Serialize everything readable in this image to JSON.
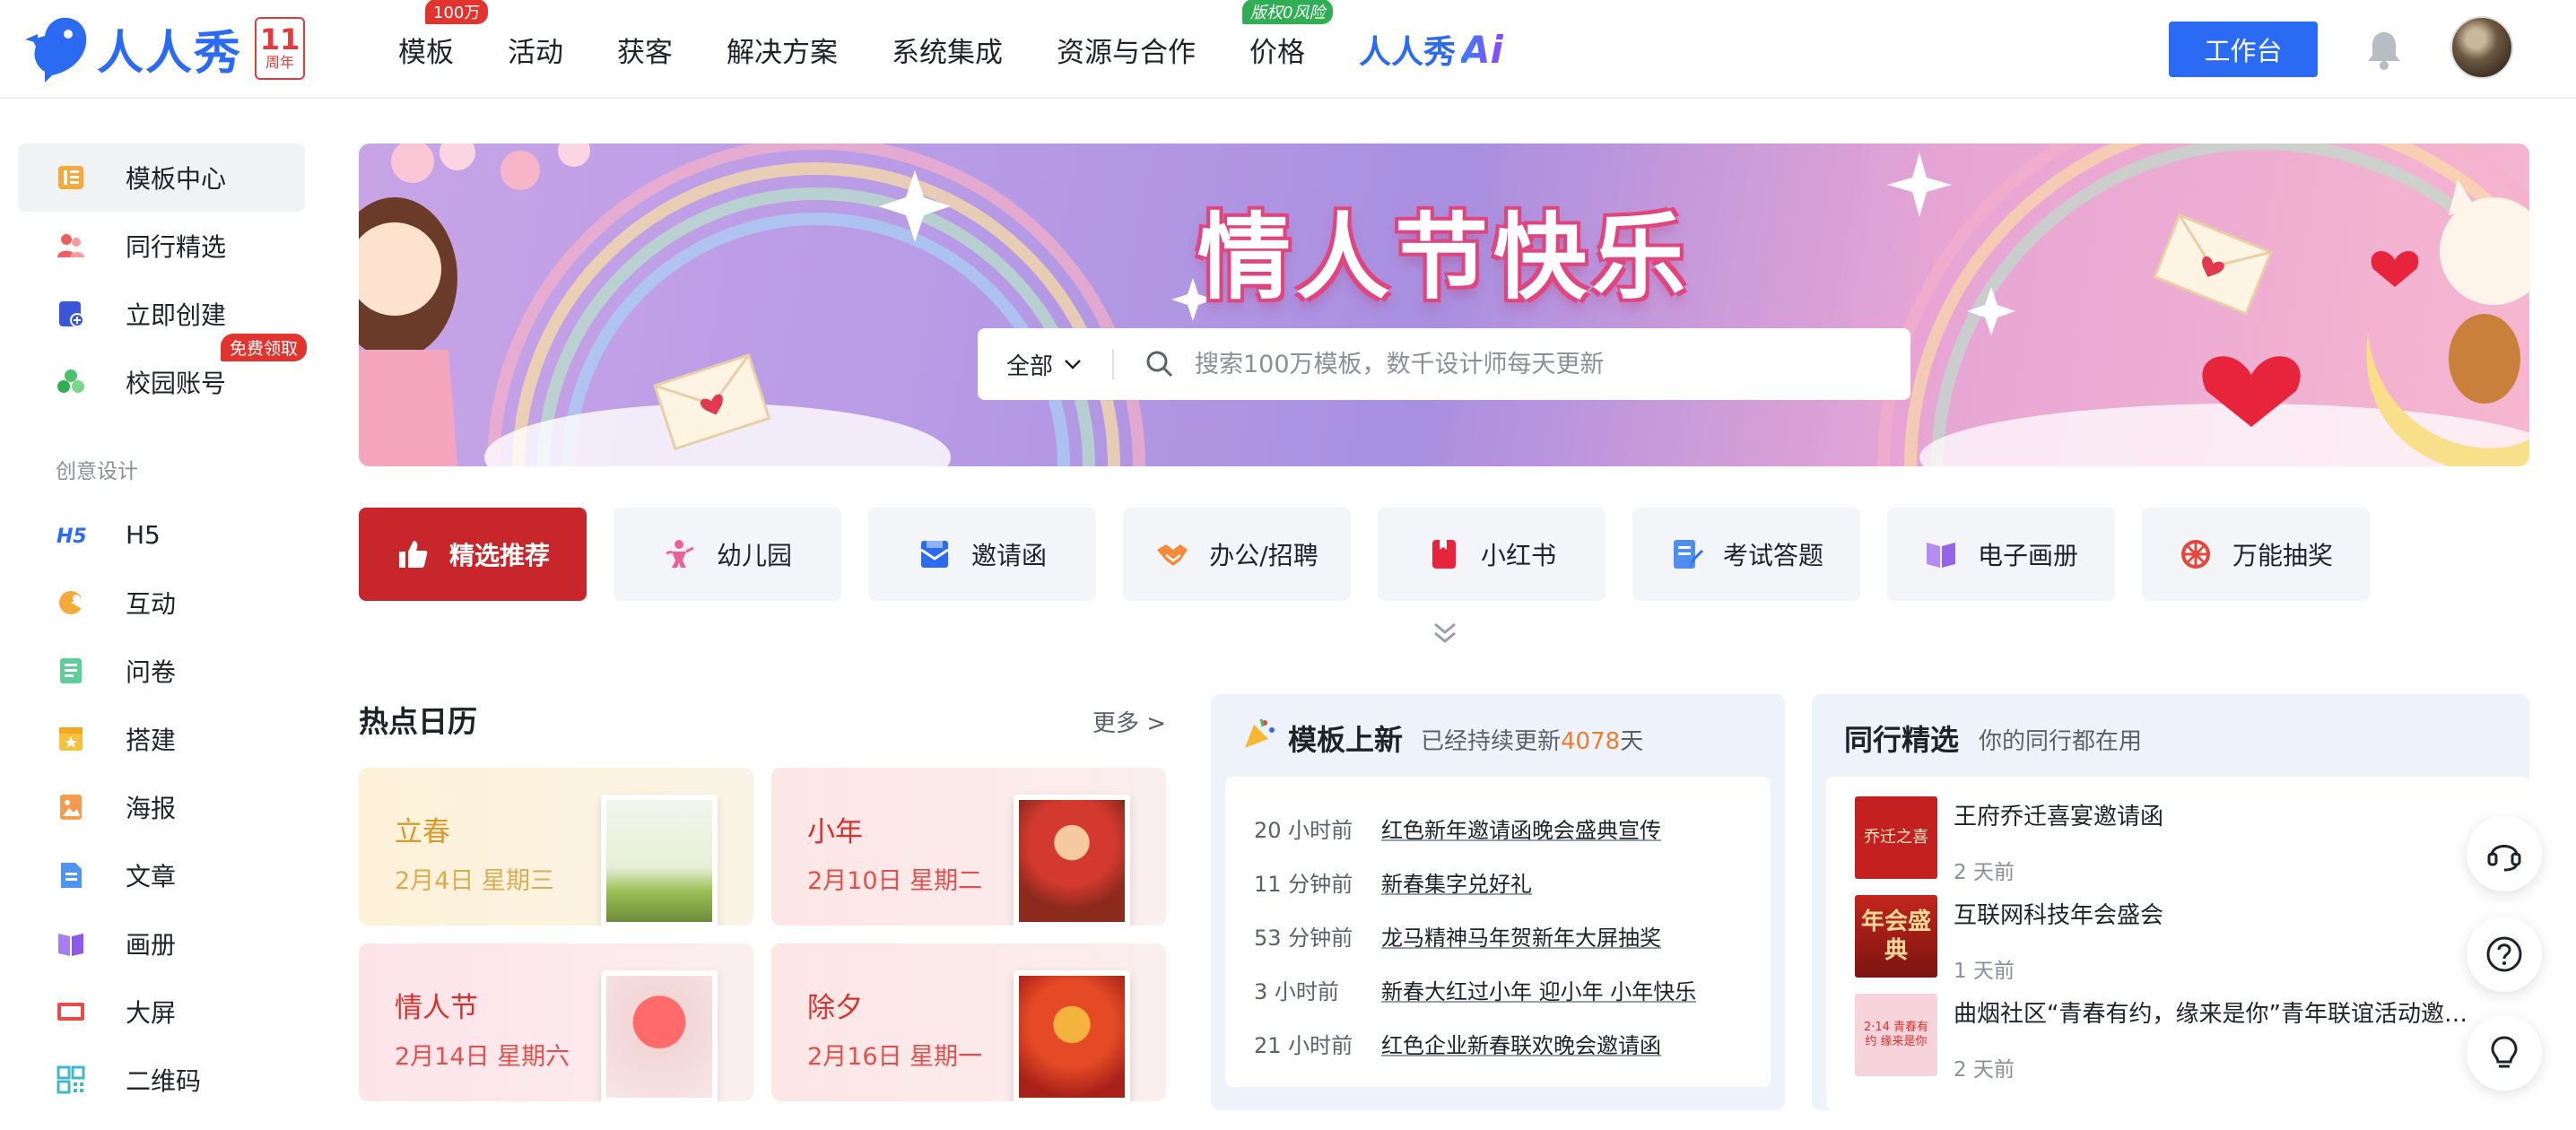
{
  "brand": {
    "name": "人人秀",
    "anniversary_number": "11",
    "anniversary_text": "周年"
  },
  "nav": {
    "items": [
      {
        "label": "模板",
        "badge": "100万"
      },
      {
        "label": "活动"
      },
      {
        "label": "获客"
      },
      {
        "label": "解决方案"
      },
      {
        "label": "系统集成"
      },
      {
        "label": "资源与合作"
      },
      {
        "label": "价格",
        "badge": "版权0风险"
      }
    ],
    "ai_label": "人人秀",
    "ai_suffix": "Ai",
    "workbench_label": "工作台"
  },
  "sidebar": {
    "items": [
      {
        "label": "模板中心",
        "icon": "template-center-icon"
      },
      {
        "label": "同行精选",
        "icon": "peers-icon"
      },
      {
        "label": "立即创建",
        "icon": "create-icon"
      },
      {
        "label": "校园账号",
        "icon": "campus-icon",
        "badge": "免费领取"
      }
    ],
    "section_label": "创意设计",
    "design_items": [
      {
        "label": "H5",
        "icon": "h5-icon"
      },
      {
        "label": "互动",
        "icon": "interaction-icon"
      },
      {
        "label": "问卷",
        "icon": "survey-icon"
      },
      {
        "label": "搭建",
        "icon": "build-icon"
      },
      {
        "label": "海报",
        "icon": "poster-icon"
      },
      {
        "label": "文章",
        "icon": "article-icon"
      },
      {
        "label": "画册",
        "icon": "album-icon"
      },
      {
        "label": "大屏",
        "icon": "big-screen-icon"
      },
      {
        "label": "二维码",
        "icon": "qrcode-icon"
      }
    ]
  },
  "banner": {
    "title": "情人节快乐",
    "search_category": "全部",
    "search_placeholder": "搜索100万模板，数千设计师每天更新"
  },
  "categories": [
    {
      "label": "精选推荐",
      "icon": "thumbs-up-icon"
    },
    {
      "label": "幼儿园",
      "icon": "kid-icon"
    },
    {
      "label": "邀请函",
      "icon": "envelope-icon"
    },
    {
      "label": "办公/招聘",
      "icon": "handshake-icon"
    },
    {
      "label": "小红书",
      "icon": "red-book-icon"
    },
    {
      "label": "考试答题",
      "icon": "exam-icon"
    },
    {
      "label": "电子画册",
      "icon": "ebook-icon"
    },
    {
      "label": "万能抽奖",
      "icon": "lottery-icon"
    }
  ],
  "hot_calendar": {
    "title": "热点日历",
    "more": "更多 >",
    "cards": [
      {
        "name": "立春",
        "date": "2月4日  星期三"
      },
      {
        "name": "小年",
        "date": "2月10日  星期二"
      },
      {
        "name": "情人节",
        "date": "2月14日  星期六"
      },
      {
        "name": "除夕",
        "date": "2月16日  星期一"
      }
    ]
  },
  "new_templates": {
    "title": "模板上新",
    "subtitle_prefix": "已经持续更新",
    "days": "4078",
    "subtitle_suffix": "天",
    "rows": [
      {
        "time": "20 小时前",
        "title": "红色新年邀请函晚会盛典宣传"
      },
      {
        "time": "11 分钟前",
        "title": "新春集字兑好礼"
      },
      {
        "time": "53 分钟前",
        "title": "龙马精神马年贺新年大屏抽奖"
      },
      {
        "time": "3 小时前",
        "title": "新春大红过小年 迎小年 小年快乐"
      },
      {
        "time": "21 小时前",
        "title": "红色企业新春联欢晚会邀请函"
      }
    ]
  },
  "peers": {
    "title": "同行精选",
    "subtitle": "你的同行都在用",
    "rows": [
      {
        "title": "王府乔迁喜宴邀请函",
        "ago": "2 天前",
        "thumb_text": "乔迁之喜"
      },
      {
        "title": "互联网科技年会盛会",
        "ago": "1 天前",
        "thumb_text": "年会盛典"
      },
      {
        "title": "曲烟社区“青春有约，缘来是你”青年联谊活动邀…",
        "ago": "2 天前",
        "thumb_text": "2·14 青春有约 缘来是你"
      }
    ]
  },
  "colors": {
    "brand_blue": "#2b6af3",
    "accent_red": "#c7262b",
    "badge_red": "#e2342f",
    "highlight_orange": "#f07c2a"
  }
}
